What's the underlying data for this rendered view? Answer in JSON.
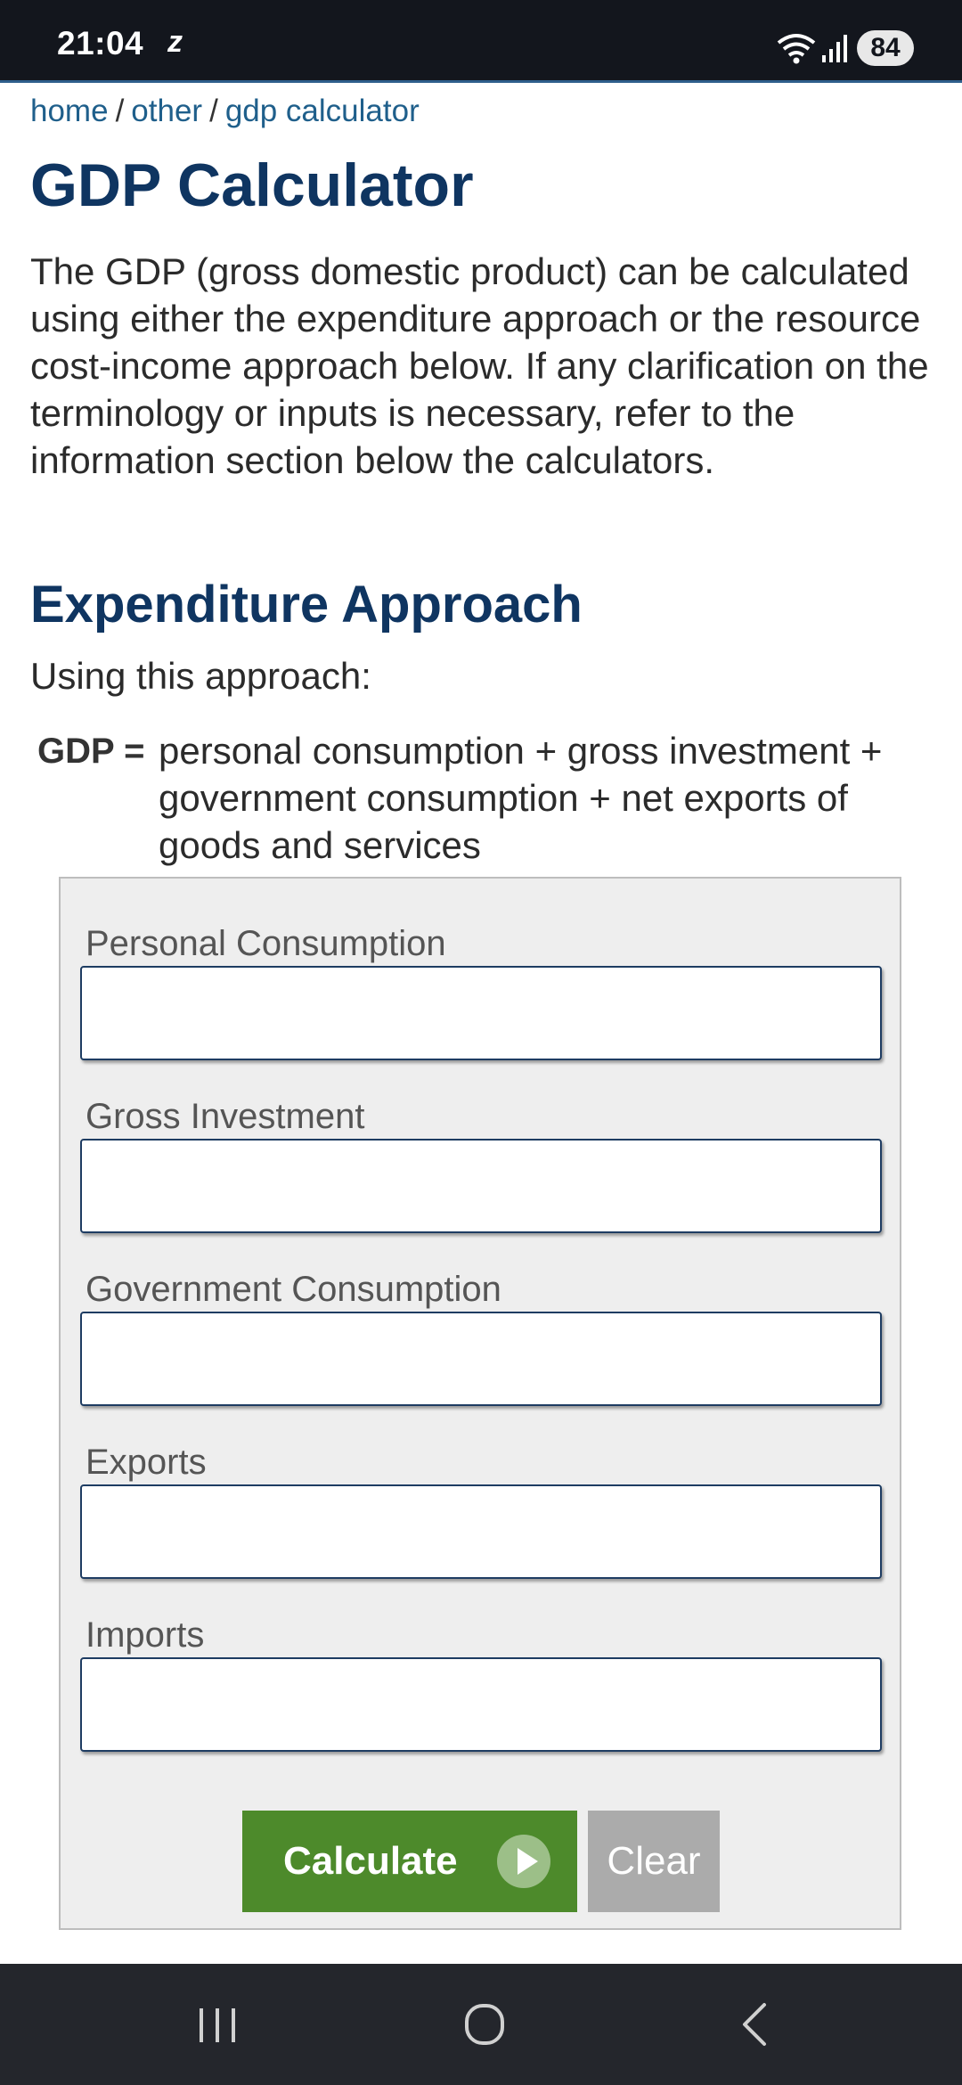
{
  "status_bar": {
    "time": "21:04",
    "notification_glyph": "z",
    "battery": "84",
    "icons": [
      "wifi-icon",
      "signal-icon",
      "battery-icon"
    ]
  },
  "breadcrumb": {
    "items": [
      "home",
      "other",
      "gdp calculator"
    ],
    "separator": "/"
  },
  "page": {
    "title": "GDP Calculator",
    "intro": "The GDP (gross domestic product) can be calculated using either the expenditure approach or the resource cost-income approach below. If any clarification on the terminology or inputs is necessary, refer to the information section below the calculators."
  },
  "expenditure": {
    "title": "Expenditure Approach",
    "using": "Using this approach:",
    "formula_label": "GDP =",
    "formula_text": "personal consumption + gross investment + government consumption + net exports of goods and services",
    "fields": [
      {
        "label": "Personal Consumption",
        "value": ""
      },
      {
        "label": "Gross Investment",
        "value": ""
      },
      {
        "label": "Government Consumption",
        "value": ""
      },
      {
        "label": "Exports",
        "value": ""
      },
      {
        "label": "Imports",
        "value": ""
      }
    ],
    "calculate_label": "Calculate",
    "clear_label": "Clear"
  },
  "colors": {
    "heading": "#0f3561",
    "link": "#1f5f8b",
    "calculate": "#4d8a2b",
    "clear": "#ababab"
  },
  "nav_bar": {
    "icons": [
      "recent-apps-icon",
      "home-icon",
      "back-icon"
    ]
  }
}
